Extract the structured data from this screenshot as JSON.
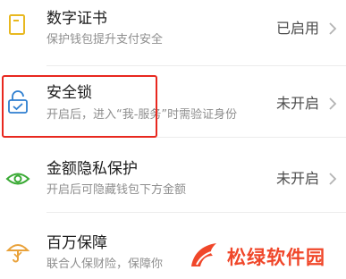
{
  "items": [
    {
      "icon": "document-certificate-icon",
      "title": "数字证书",
      "subtitle": "保护钱包提升支付安全",
      "status": "已启用"
    },
    {
      "icon": "lock-check-icon",
      "title": "安全锁",
      "subtitle": "开启后，进入“我-服务”时需验证身份",
      "status": "未开启"
    },
    {
      "icon": "eye-icon",
      "title": "金额隐私保护",
      "subtitle": "开启后可隐藏钱包下方金额",
      "status": "未开启"
    },
    {
      "icon": "umbrella-icon",
      "title": "百万保障",
      "subtitle": "联合人保财险，保障你"
    }
  ],
  "watermark": {
    "text": "松绿软件园",
    "color": "#f0472a"
  },
  "colors": {
    "accent_green": "#3aaa35",
    "cert_yellow": "#e8b820",
    "lock_blue": "#2f7fd0",
    "umbrella_orange": "#e9a23b",
    "highlight_red": "#e8281f"
  }
}
